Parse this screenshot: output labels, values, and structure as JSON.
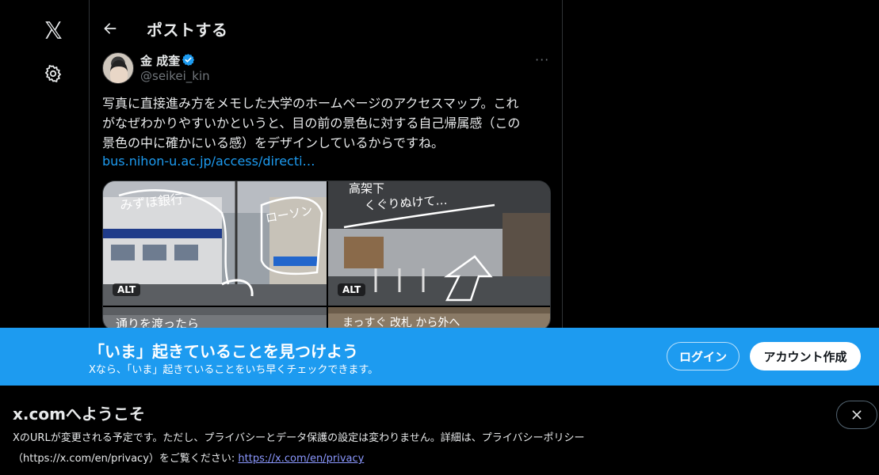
{
  "sidebar": {
    "logo_icon": "x-logo-icon",
    "settings_icon": "gear-icon"
  },
  "header": {
    "back_icon": "arrow-left-icon",
    "title": "ポストする"
  },
  "post": {
    "author": {
      "display_name": "金 成奎",
      "handle": "@seikei_kin",
      "verified": true
    },
    "more_label": "···",
    "text": "写真に直接進み方をメモした大学のホームページのアクセスマップ。これ\nがなぜわかりやすいかというと、目の前の景色に対する自己帰属感（この\n景色の中に確かにいる感）をデザインしているからですね。",
    "link": "bus.nihon-u.ac.jp/access/directi…",
    "media": [
      {
        "alt_badge": "ALT",
        "caption": "みずほ銀行",
        "caption2": "ローソン"
      },
      {
        "alt_badge": "ALT",
        "caption": "高架下",
        "caption2": "くぐりぬけて…"
      },
      {
        "alt_badge": "",
        "caption": "通りを渡ったら"
      },
      {
        "alt_badge": "",
        "caption": "まっすぐ 改札 から外へ"
      }
    ]
  },
  "banner": {
    "title": "「いま」起きていることを見つけよう",
    "subtitle": "Xなら、「いま」起きていることをいち早くチェックできます。",
    "login_label": "ログイン",
    "signup_label": "アカウント作成",
    "background": "#1d9bf0"
  },
  "notice": {
    "title": "x.comへようこそ",
    "body": "XのURLが変更される予定です。ただし、プライバシーとデータ保護の設定は変わりません。詳細は、プライバシーポリシー（https://x.com/en/privacy）をご覧ください: ",
    "link": "https://x.com/en/privacy",
    "close_icon": "close-icon"
  }
}
